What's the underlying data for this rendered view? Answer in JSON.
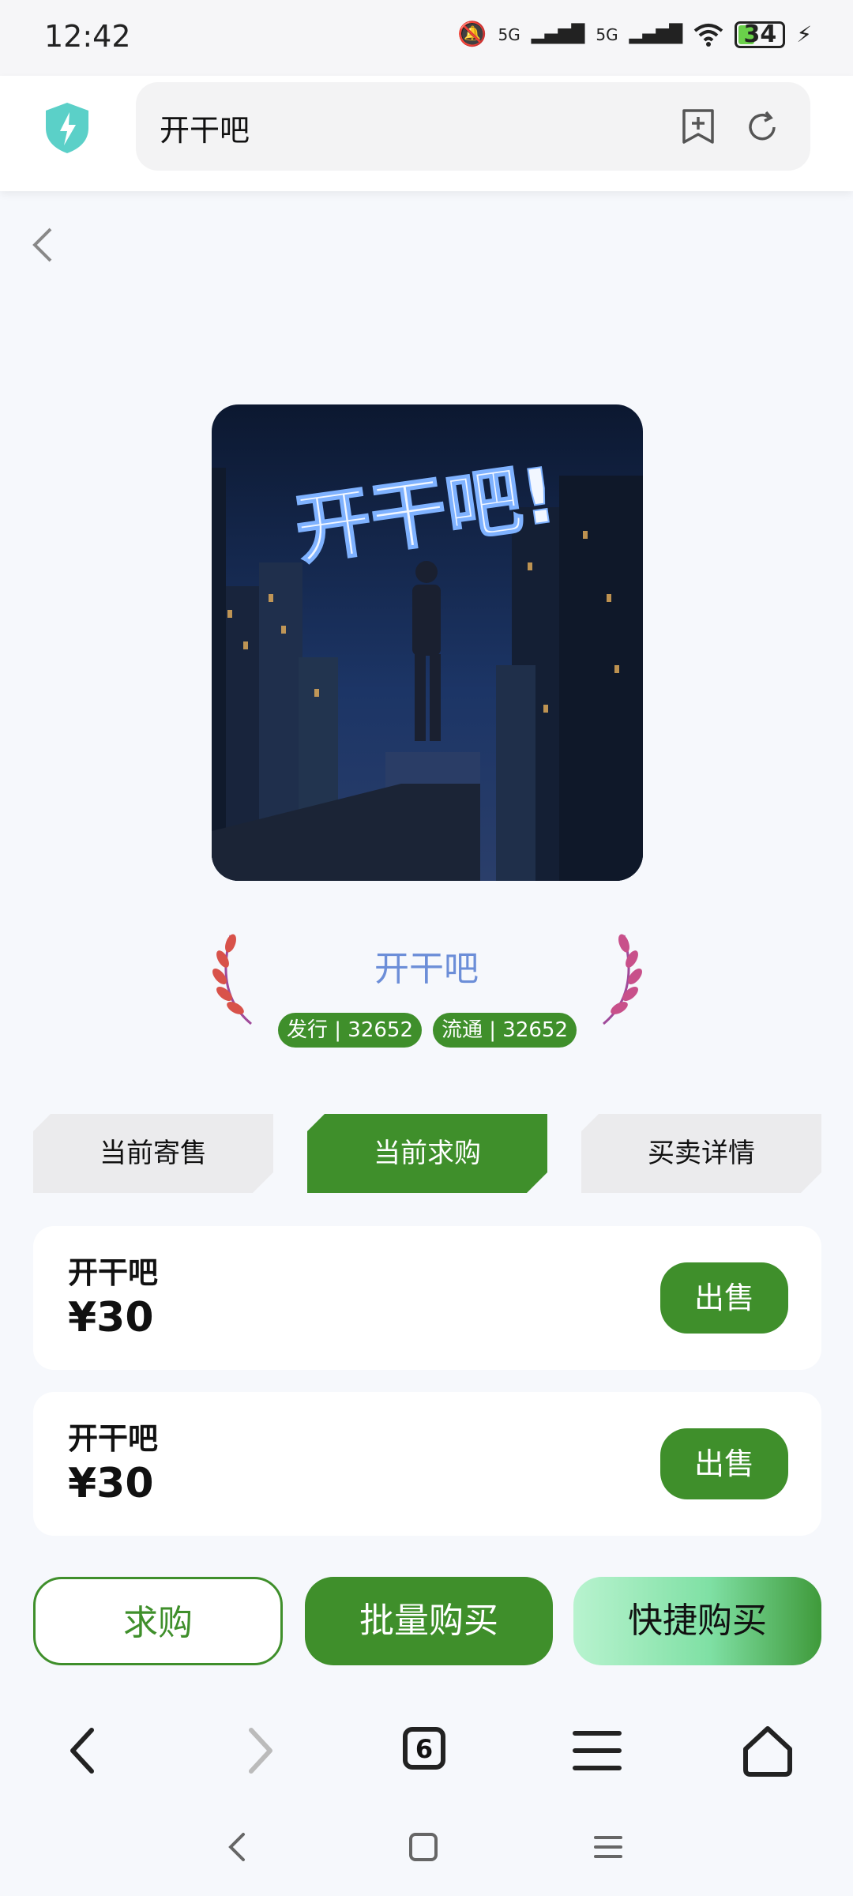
{
  "status_bar": {
    "time": "12:42",
    "signal_a": "5G",
    "signal_b": "5G",
    "battery": "34"
  },
  "browser": {
    "url_text": "开干吧"
  },
  "product": {
    "title": "开干吧",
    "issue_tag": "发行 | 32652",
    "circulation_tag": "流通 | 32652"
  },
  "tabs": [
    {
      "label": "当前寄售",
      "active": false
    },
    {
      "label": "当前求购",
      "active": true
    },
    {
      "label": "买卖详情",
      "active": false
    }
  ],
  "orders": [
    {
      "name": "开干吧",
      "price": "¥30",
      "action": "出售"
    },
    {
      "name": "开干吧",
      "price": "¥30",
      "action": "出售"
    }
  ],
  "actions": {
    "request": "求购",
    "batch_buy": "批量购买",
    "quick_buy": "快捷购买"
  },
  "nav": {
    "tab_count": "6"
  },
  "colors": {
    "accent": "#3f8f2b",
    "title": "#6c8ed8"
  }
}
